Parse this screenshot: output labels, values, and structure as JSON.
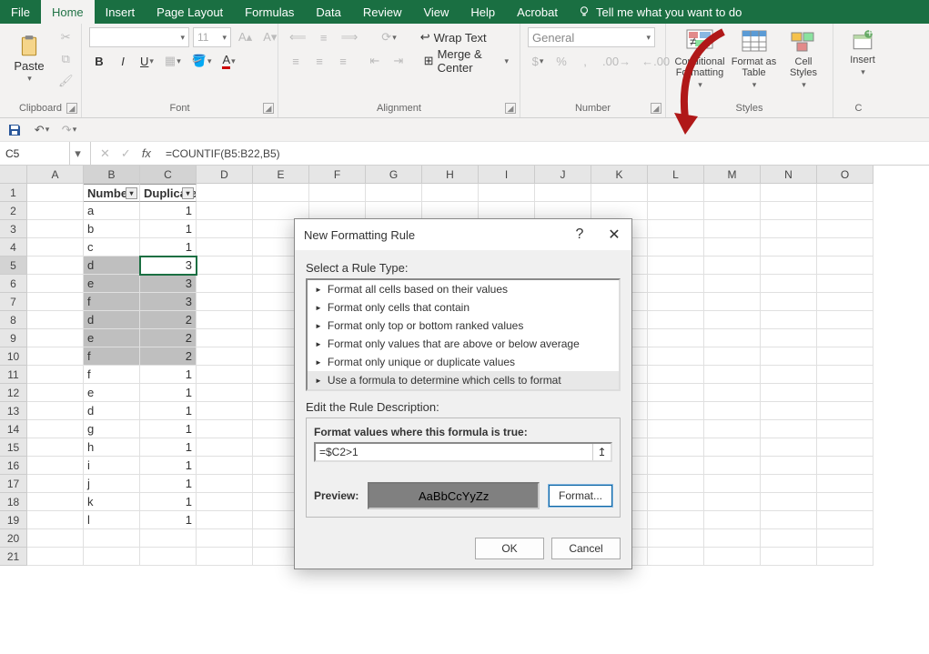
{
  "tabs": {
    "file": "File",
    "home": "Home",
    "insert": "Insert",
    "pagelayout": "Page Layout",
    "formulas": "Formulas",
    "data": "Data",
    "review": "Review",
    "view": "View",
    "help": "Help",
    "acrobat": "Acrobat",
    "tell": "Tell me what you want to do"
  },
  "ribbon": {
    "clipboard": {
      "paste": "Paste",
      "label": "Clipboard"
    },
    "font": {
      "label": "Font"
    },
    "alignment": {
      "wrap": "Wrap Text",
      "merge": "Merge & Center",
      "label": "Alignment"
    },
    "number": {
      "general": "General",
      "label": "Number"
    },
    "styles": {
      "cf": "Conditional\nFormatting",
      "fat": "Format as\nTable",
      "cs": "Cell\nStyles",
      "label": "Styles"
    },
    "cells": {
      "insert": "Insert",
      "label": "C"
    }
  },
  "namebox": "C5",
  "formula": "=COUNTIF(B5:B22,B5)",
  "columns": [
    "A",
    "B",
    "C",
    "D",
    "E",
    "F",
    "G",
    "H",
    "I",
    "J",
    "K",
    "L",
    "M",
    "N",
    "O"
  ],
  "headers": {
    "b": "Number",
    "c": "Duplicates"
  },
  "rows": [
    {
      "b": "a",
      "c": 1
    },
    {
      "b": "b",
      "c": 1
    },
    {
      "b": "c",
      "c": 1
    },
    {
      "b": "d",
      "c": 3,
      "shade": true,
      "active": true
    },
    {
      "b": "e",
      "c": 3,
      "shade": true
    },
    {
      "b": "f",
      "c": 3,
      "shade": true
    },
    {
      "b": "d",
      "c": 2,
      "shade": true
    },
    {
      "b": "e",
      "c": 2,
      "shade": true
    },
    {
      "b": "f",
      "c": 2,
      "shade": true
    },
    {
      "b": "f",
      "c": 1
    },
    {
      "b": "e",
      "c": 1
    },
    {
      "b": "d",
      "c": 1
    },
    {
      "b": "g",
      "c": 1
    },
    {
      "b": "h",
      "c": 1
    },
    {
      "b": "i",
      "c": 1
    },
    {
      "b": "j",
      "c": 1
    },
    {
      "b": "k",
      "c": 1
    },
    {
      "b": "l",
      "c": 1
    },
    {
      "b": "",
      "c": ""
    }
  ],
  "dialog": {
    "title": "New Formatting Rule",
    "select_label": "Select a Rule Type:",
    "rules": [
      "Format all cells based on their values",
      "Format only cells that contain",
      "Format only top or bottom ranked values",
      "Format only values that are above or below average",
      "Format only unique or duplicate values",
      "Use a formula to determine which cells to format"
    ],
    "edit_label": "Edit the Rule Description:",
    "formula_label": "Format values where this formula is true:",
    "formula": "=$C2>1",
    "preview_label": "Preview:",
    "preview_text": "AaBbCcYyZz",
    "format_btn": "Format...",
    "ok": "OK",
    "cancel": "Cancel"
  }
}
